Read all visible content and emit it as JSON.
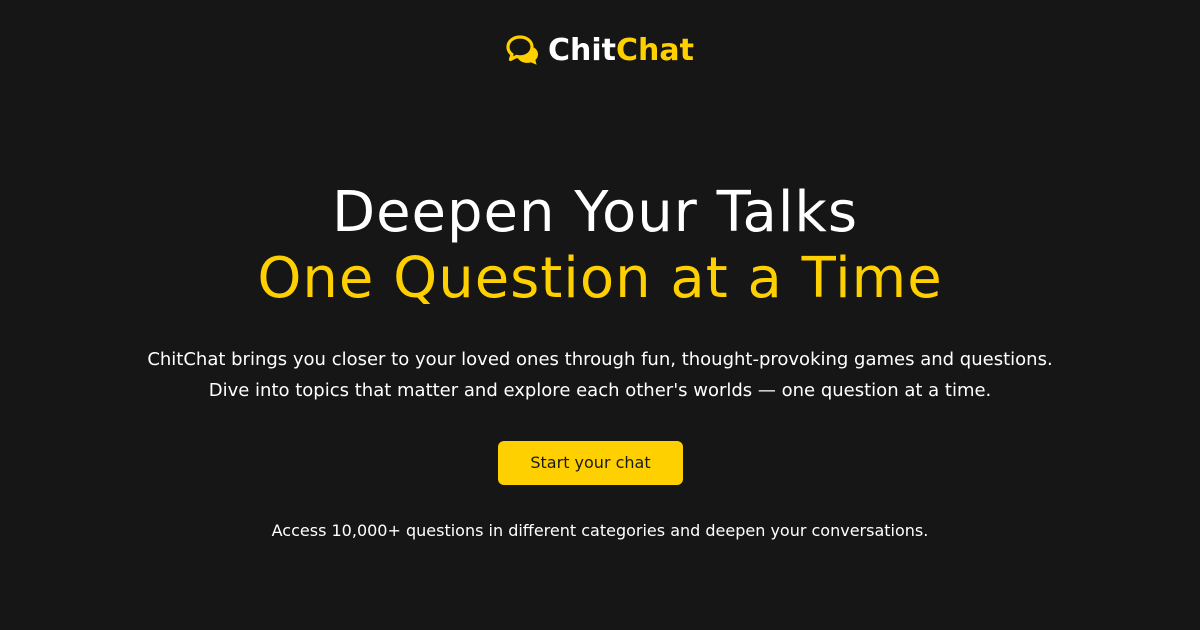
{
  "logo": {
    "icon": "speech-bubbles-icon",
    "name_part1": "Chit",
    "name_part2": "Chat"
  },
  "hero": {
    "headline_line1": "Deepen Your Talks",
    "headline_line2": "One Question at a Time",
    "description_line1": "ChitChat brings you closer to your loved ones through fun, thought-provoking games and questions.",
    "description_line2": "Dive into topics that matter and explore each other's worlds — one question at a time.",
    "cta_label": "Start your chat",
    "footnote": "Access 10,000+ questions in different categories and deepen your conversations."
  },
  "colors": {
    "background": "#161616",
    "accent": "#ffd000",
    "text": "#ffffff",
    "button_text": "#1a1a1a"
  }
}
